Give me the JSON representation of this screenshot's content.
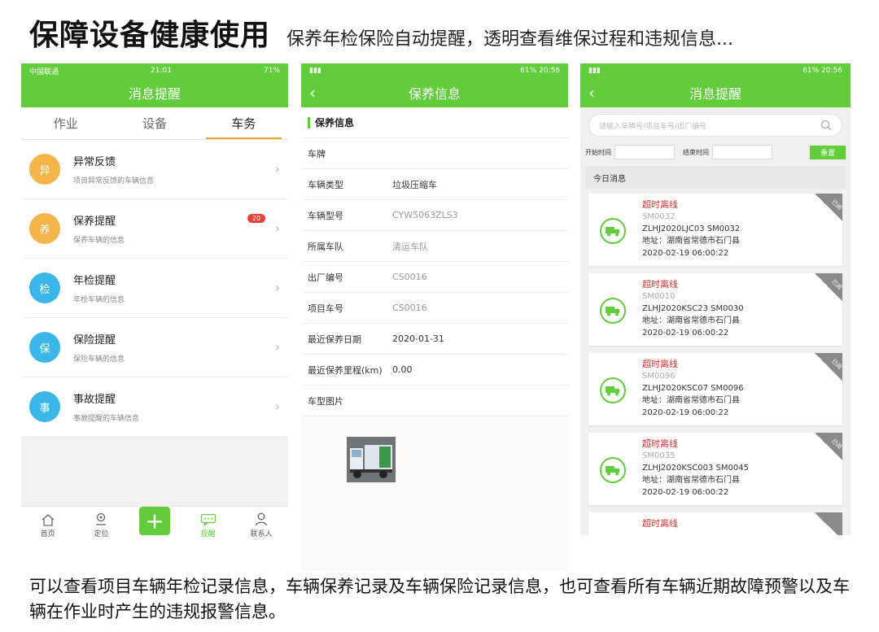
{
  "headline": {
    "title": "保障设备健康使用",
    "subtitle": "保养年检保险自动提醒，透明查看维保过程和违规信息..."
  },
  "footer": {
    "text": "可以查看项目车辆年检记录信息，车辆保养记录及车辆保险记录信息，也可查看所有车辆近期故障预警以及车辆在作业时产生的违规报警信息。"
  },
  "phone1": {
    "status": {
      "carrier": "中国联通",
      "time": "21:01",
      "battery": "71%"
    },
    "title": "消息提醒",
    "tabs": [
      {
        "label": "作业"
      },
      {
        "label": "设备"
      },
      {
        "label": "车务"
      }
    ],
    "items": [
      {
        "title": "异常反馈",
        "sub": "项目异常反馈的车辆信息",
        "color": "#f5b44a",
        "icon": "异"
      },
      {
        "title": "保养提醒",
        "sub": "保养车辆的信息",
        "color": "#f5b44a",
        "icon": "养",
        "badge": "20"
      },
      {
        "title": "年检提醒",
        "sub": "年检车辆的信息",
        "color": "#3bb6e8",
        "icon": "检"
      },
      {
        "title": "保险提醒",
        "sub": "保险车辆的信息",
        "color": "#3bb6e8",
        "icon": "保"
      },
      {
        "title": "事故提醒",
        "sub": "事故提醒的车辆信息",
        "color": "#3bb6e8",
        "icon": "事"
      }
    ],
    "nav": [
      {
        "label": "首页"
      },
      {
        "label": "定位"
      },
      {
        "label": ""
      },
      {
        "label": "提醒"
      },
      {
        "label": "联系人"
      }
    ]
  },
  "phone2": {
    "status": {
      "battery": "61%",
      "time": "20:56"
    },
    "title": "保养信息",
    "section": "保养信息",
    "fields": [
      {
        "k": "车牌",
        "v": ""
      },
      {
        "k": "车辆类型",
        "v": "垃圾压缩车"
      },
      {
        "k": "车辆型号",
        "v": "CYW5063ZLS3"
      },
      {
        "k": "所属车队",
        "v": "清运车队"
      },
      {
        "k": "出厂编号",
        "v": "CS0016"
      },
      {
        "k": "项目车号",
        "v": "CS0016"
      },
      {
        "k": "最近保养日期",
        "v": "2020-01-31"
      },
      {
        "k": "最近保养里程(km)",
        "v": "0.00"
      },
      {
        "k": "车型图片",
        "v": ""
      }
    ]
  },
  "phone3": {
    "status": {
      "battery": "61%",
      "time": "20:56"
    },
    "title": "消息提醒",
    "search_placeholder": "请输入车牌号/项目车号/出厂编号",
    "filter": {
      "start": "开始时间",
      "end": "结束时间",
      "reset": "重置"
    },
    "today": "今日消息",
    "cards": [
      {
        "warn": "超时离线",
        "code": "SM0032",
        "vin": "ZLHJ2020LJC03 SM0032",
        "addr": "地址：湖南省常德市石门县",
        "time": "2020-02-19 06:00:22",
        "tag": "已阅"
      },
      {
        "warn": "超时离线",
        "code": "SM0010",
        "vin": "ZLHJ2020KSC23 SM0030",
        "addr": "地址：湖南省常德市石门县",
        "time": "2020-02-19 06:00:22",
        "tag": "已阅"
      },
      {
        "warn": "超时离线",
        "code": "SM0096",
        "vin": "ZLHJ2020KSC07    SM0096",
        "addr": "地址：湖南省常德市石门县",
        "time": "2020-02-19 06:00:22",
        "tag": "已阅"
      },
      {
        "warn": "超时离线",
        "code": "SM0035",
        "vin": "ZLHJ2020KSC003    SM0045",
        "addr": "地址：湖南省常德市石门县",
        "time": "2020-02-19 06:00:22",
        "tag": "已阅"
      },
      {
        "warn": "超时离线",
        "code": "",
        "vin": "",
        "addr": "",
        "time": "",
        "tag": ""
      }
    ]
  }
}
